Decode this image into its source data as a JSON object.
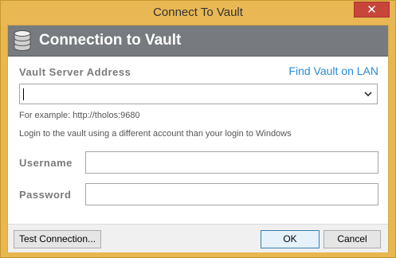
{
  "window": {
    "title": "Connect To Vault",
    "close_label": "✕"
  },
  "banner": {
    "icon": "database-icon",
    "heading": "Connection to Vault"
  },
  "form": {
    "server_label": "Vault Server Address",
    "find_link": "Find Vault on LAN",
    "server_value": "",
    "example_text": "For example: http://tholos:9680",
    "login_hint": "Login to the vault using a different account than your login to Windows",
    "username_label": "Username",
    "username_value": "",
    "password_label": "Password",
    "password_value": ""
  },
  "footer": {
    "test_button": "Test Connection...",
    "ok_button": "OK",
    "cancel_button": "Cancel"
  },
  "colors": {
    "frame": "#e9b855",
    "banner": "#777a7e",
    "link": "#2a8ad4",
    "close": "#c7453a"
  }
}
